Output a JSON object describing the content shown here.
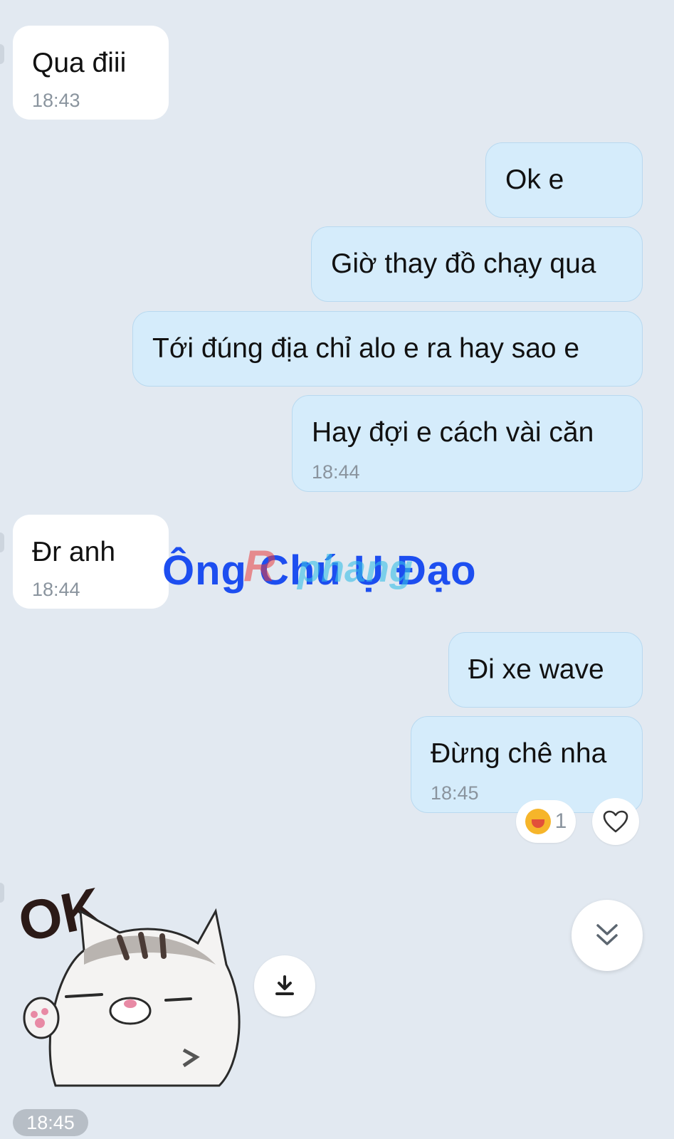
{
  "messages": [
    {
      "text": "Qua điii",
      "time": "18:43"
    },
    {
      "text": "Ok e"
    },
    {
      "text": "Giờ thay đồ chạy qua"
    },
    {
      "text": "Tới đúng địa chỉ alo e ra hay sao e"
    },
    {
      "text": "Hay đợi e cách vài căn",
      "time": "18:44"
    },
    {
      "text": "Đr anh",
      "time": "18:44"
    },
    {
      "text": "Đi xe wave"
    },
    {
      "text": "Đừng chê nha",
      "time": "18:45"
    }
  ],
  "reaction": {
    "emoji": "laughing-crying-emoji",
    "count": "1"
  },
  "sticker": {
    "caption": "OK",
    "time": "18:45"
  },
  "watermark": {
    "main": "Ông Chú Ụ Đạo",
    "overlay1": "R",
    "overlay2": "phang"
  },
  "icons": {
    "heart": "heart-icon",
    "download": "download-icon",
    "scroll": "chevron-double-down-icon"
  },
  "colors": {
    "background": "#e2e9f1",
    "incoming": "#ffffff",
    "outgoing": "#d5ecfb",
    "watermark": "#1d4ef0"
  }
}
